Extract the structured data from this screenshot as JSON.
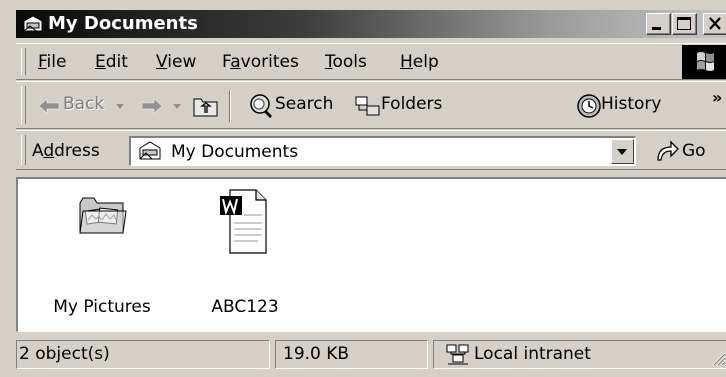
{
  "window": {
    "title": "My Documents",
    "title_icon": "folder-hand-icon",
    "controls": {
      "minimize": "minimize-icon",
      "maximize": "maximize-icon",
      "close": "close-icon"
    }
  },
  "menu": {
    "items": [
      {
        "label": "File",
        "accel": "F",
        "rest": "ile"
      },
      {
        "label": "Edit",
        "accel": "E",
        "rest": "dit"
      },
      {
        "label": "View",
        "accel": "V",
        "rest": "iew"
      },
      {
        "label": "Favorites",
        "pre": "F",
        "accel": "a",
        "rest": "vorites"
      },
      {
        "label": "Tools",
        "accel": "T",
        "rest": "ools"
      },
      {
        "label": "Help",
        "accel": "H",
        "rest": "elp"
      }
    ],
    "logo": "windows-logo-icon"
  },
  "toolbar": {
    "back": "Back",
    "search": "Search",
    "folders": "Folders",
    "history": "History",
    "overflow": "»"
  },
  "address": {
    "label_pre": "A",
    "label_accel": "d",
    "label_rest": "dress",
    "value": "My Documents",
    "go": "Go"
  },
  "files": [
    {
      "name": "My Pictures",
      "icon": "pictures-folder-icon"
    },
    {
      "name": "ABC123",
      "icon": "word-document-icon"
    }
  ],
  "status": {
    "objects": "2 object(s)",
    "size": "19.0 KB",
    "zone": "Local intranet"
  }
}
